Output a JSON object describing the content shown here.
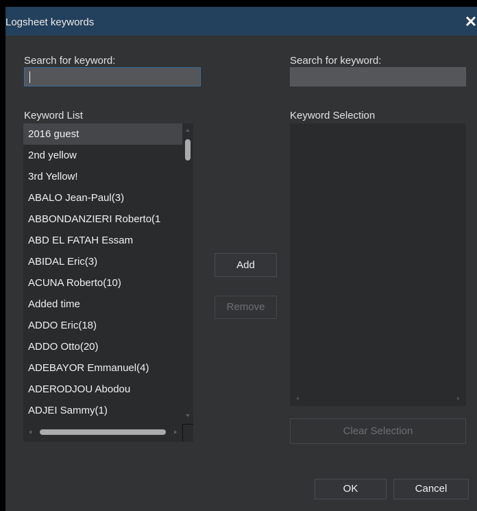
{
  "dialog": {
    "title": "Logsheet keywords",
    "close_symbol": "✕"
  },
  "left": {
    "search_label": "Search for keyword:",
    "search_value": "",
    "list_label": "Keyword List",
    "items": [
      "2016 guest",
      "2nd yellow",
      "3rd Yellow!",
      "ABALO Jean-Paul(3)",
      "ABBONDANZIERI Roberto(1",
      "ABD EL FATAH Essam",
      "ABIDAL Eric(3)",
      "ACUNA Roberto(10)",
      "Added time",
      "ADDO Eric(18)",
      "ADDO Otto(20)",
      "ADEBAYOR Emmanuel(4)",
      "ADERODJOU Abodou",
      "ADJEI Sammy(1)"
    ],
    "selected_index": 0
  },
  "middle": {
    "add_label": "Add",
    "remove_label": "Remove"
  },
  "right": {
    "search_label": "Search for keyword:",
    "search_value": "",
    "selection_label": "Keyword Selection",
    "clear_label": "Clear Selection"
  },
  "footer": {
    "ok_label": "OK",
    "cancel_label": "Cancel"
  },
  "colors": {
    "titlebar": "#23405c",
    "dialog_bg": "#313335",
    "panel_bg": "#2a2b2d",
    "focus_border": "#3b6e9c"
  }
}
